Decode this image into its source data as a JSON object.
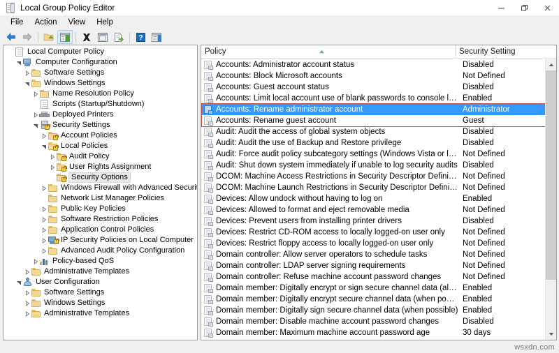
{
  "window": {
    "title": "Local Group Policy Editor",
    "app_icon": "policy-document-icon",
    "minimize_label": "─",
    "maximize_label": "❐",
    "close_label": "✕"
  },
  "menubar": {
    "items": [
      {
        "label": "File"
      },
      {
        "label": "Action"
      },
      {
        "label": "View"
      },
      {
        "label": "Help"
      }
    ]
  },
  "toolbar": {
    "buttons": [
      {
        "name": "back-icon",
        "tip": "Back"
      },
      {
        "name": "forward-icon",
        "tip": "Forward"
      },
      {
        "name": "up-one-level-icon",
        "tip": "Up One Level"
      },
      {
        "name": "show-hide-console-tree-icon",
        "tip": "Show/Hide Console Tree",
        "selected": true
      },
      {
        "name": "delete-icon",
        "tip": "Delete"
      },
      {
        "name": "properties-icon",
        "tip": "Properties"
      },
      {
        "name": "export-list-icon",
        "tip": "Export List"
      },
      {
        "name": "help-icon",
        "tip": "Help"
      },
      {
        "name": "show-hide-action-pane-icon",
        "tip": "Show/Hide Action Pane"
      }
    ]
  },
  "tree": {
    "items": [
      {
        "label": "Local Computer Policy",
        "indent": 0,
        "icon": "policy-document-icon",
        "expander": "none",
        "selected": false
      },
      {
        "label": "Computer Configuration",
        "indent": 1,
        "icon": "computer-icon",
        "expander": "expanded",
        "selected": false
      },
      {
        "label": "Software Settings",
        "indent": 2,
        "icon": "folder-icon",
        "expander": "collapsed",
        "selected": false
      },
      {
        "label": "Windows Settings",
        "indent": 2,
        "icon": "folder-icon",
        "expander": "expanded",
        "selected": false
      },
      {
        "label": "Name Resolution Policy",
        "indent": 3,
        "icon": "folder-icon",
        "expander": "collapsed",
        "selected": false
      },
      {
        "label": "Scripts (Startup/Shutdown)",
        "indent": 3,
        "icon": "script-icon",
        "expander": "none",
        "selected": false
      },
      {
        "label": "Deployed Printers",
        "indent": 3,
        "icon": "printer-icon",
        "expander": "collapsed",
        "selected": false
      },
      {
        "label": "Security Settings",
        "indent": 3,
        "icon": "security-server-icon",
        "expander": "expanded",
        "selected": false
      },
      {
        "label": "Account Policies",
        "indent": 4,
        "icon": "folder-lock-icon",
        "expander": "collapsed",
        "selected": false
      },
      {
        "label": "Local Policies",
        "indent": 4,
        "icon": "folder-lock-icon",
        "expander": "expanded",
        "selected": false
      },
      {
        "label": "Audit Policy",
        "indent": 5,
        "icon": "folder-lock-icon",
        "expander": "collapsed",
        "selected": false
      },
      {
        "label": "User Rights Assignment",
        "indent": 5,
        "icon": "folder-lock-icon",
        "expander": "collapsed",
        "selected": false
      },
      {
        "label": "Security Options",
        "indent": 5,
        "icon": "folder-lock-icon",
        "expander": "none",
        "selected": true
      },
      {
        "label": "Windows Firewall with Advanced Security",
        "indent": 4,
        "icon": "folder-icon",
        "expander": "collapsed",
        "selected": false
      },
      {
        "label": "Network List Manager Policies",
        "indent": 4,
        "icon": "folder-icon",
        "expander": "none",
        "selected": false
      },
      {
        "label": "Public Key Policies",
        "indent": 4,
        "icon": "folder-icon",
        "expander": "collapsed",
        "selected": false
      },
      {
        "label": "Software Restriction Policies",
        "indent": 4,
        "icon": "folder-icon",
        "expander": "collapsed",
        "selected": false
      },
      {
        "label": "Application Control Policies",
        "indent": 4,
        "icon": "folder-icon",
        "expander": "collapsed",
        "selected": false
      },
      {
        "label": "IP Security Policies on Local Computer",
        "indent": 4,
        "icon": "ip-security-icon",
        "expander": "collapsed",
        "selected": false
      },
      {
        "label": "Advanced Audit Policy Configuration",
        "indent": 4,
        "icon": "folder-icon",
        "expander": "collapsed",
        "selected": false
      },
      {
        "label": "Policy-based QoS",
        "indent": 3,
        "icon": "qos-chart-icon",
        "expander": "collapsed",
        "selected": false
      },
      {
        "label": "Administrative Templates",
        "indent": 2,
        "icon": "folder-icon",
        "expander": "collapsed",
        "selected": false
      },
      {
        "label": "User Configuration",
        "indent": 1,
        "icon": "user-icon",
        "expander": "expanded",
        "selected": false
      },
      {
        "label": "Software Settings",
        "indent": 2,
        "icon": "folder-icon",
        "expander": "collapsed",
        "selected": false
      },
      {
        "label": "Windows Settings",
        "indent": 2,
        "icon": "folder-icon",
        "expander": "collapsed",
        "selected": false
      },
      {
        "label": "Administrative Templates",
        "indent": 2,
        "icon": "folder-icon",
        "expander": "collapsed",
        "selected": false
      }
    ]
  },
  "list": {
    "columns": [
      {
        "label": "Policy",
        "sort": "ascending"
      },
      {
        "label": "Security Setting",
        "sort": "none"
      }
    ],
    "rows": [
      {
        "policy": "Accounts: Administrator account status",
        "setting": "Disabled",
        "selected": false
      },
      {
        "policy": "Accounts: Block Microsoft accounts",
        "setting": "Not Defined",
        "selected": false
      },
      {
        "policy": "Accounts: Guest account status",
        "setting": "Disabled",
        "selected": false
      },
      {
        "policy": "Accounts: Limit local account use of blank passwords to console logon only",
        "setting": "Enabled",
        "selected": false
      },
      {
        "policy": "Accounts: Rename administrator account",
        "setting": "Administrator",
        "selected": true
      },
      {
        "policy": "Accounts: Rename guest account",
        "setting": "Guest",
        "selected": false
      },
      {
        "policy": "Audit: Audit the access of global system objects",
        "setting": "Disabled",
        "selected": false
      },
      {
        "policy": "Audit: Audit the use of Backup and Restore privilege",
        "setting": "Disabled",
        "selected": false
      },
      {
        "policy": "Audit: Force audit policy subcategory settings (Windows Vista or later) to ov...",
        "setting": "Not Defined",
        "selected": false
      },
      {
        "policy": "Audit: Shut down system immediately if unable to log security audits",
        "setting": "Disabled",
        "selected": false
      },
      {
        "policy": "DCOM: Machine Access Restrictions in Security Descriptor Definition Langua...",
        "setting": "Not Defined",
        "selected": false
      },
      {
        "policy": "DCOM: Machine Launch Restrictions in Security Descriptor Definition Langu...",
        "setting": "Not Defined",
        "selected": false
      },
      {
        "policy": "Devices: Allow undock without having to log on",
        "setting": "Enabled",
        "selected": false
      },
      {
        "policy": "Devices: Allowed to format and eject removable media",
        "setting": "Not Defined",
        "selected": false
      },
      {
        "policy": "Devices: Prevent users from installing printer drivers",
        "setting": "Disabled",
        "selected": false
      },
      {
        "policy": "Devices: Restrict CD-ROM access to locally logged-on user only",
        "setting": "Not Defined",
        "selected": false
      },
      {
        "policy": "Devices: Restrict floppy access to locally logged-on user only",
        "setting": "Not Defined",
        "selected": false
      },
      {
        "policy": "Domain controller: Allow server operators to schedule tasks",
        "setting": "Not Defined",
        "selected": false
      },
      {
        "policy": "Domain controller: LDAP server signing requirements",
        "setting": "Not Defined",
        "selected": false
      },
      {
        "policy": "Domain controller: Refuse machine account password changes",
        "setting": "Not Defined",
        "selected": false
      },
      {
        "policy": "Domain member: Digitally encrypt or sign secure channel data (always)",
        "setting": "Enabled",
        "selected": false
      },
      {
        "policy": "Domain member: Digitally encrypt secure channel data (when possible)",
        "setting": "Enabled",
        "selected": false
      },
      {
        "policy": "Domain member: Digitally sign secure channel data (when possible)",
        "setting": "Enabled",
        "selected": false
      },
      {
        "policy": "Domain member: Disable machine account password changes",
        "setting": "Disabled",
        "selected": false
      },
      {
        "policy": "Domain member: Maximum machine account password age",
        "setting": "30 days",
        "selected": false
      }
    ]
  },
  "annotation": {
    "highlight_box": "red-outline-around-rename-account-rows"
  },
  "watermark": {
    "text": "wsxdn.com"
  },
  "colors": {
    "selection_blue": "#3399ff",
    "annotation_red": "#c0504d",
    "window_bg": "#f0f0f0",
    "pane_bg": "#ffffff"
  }
}
